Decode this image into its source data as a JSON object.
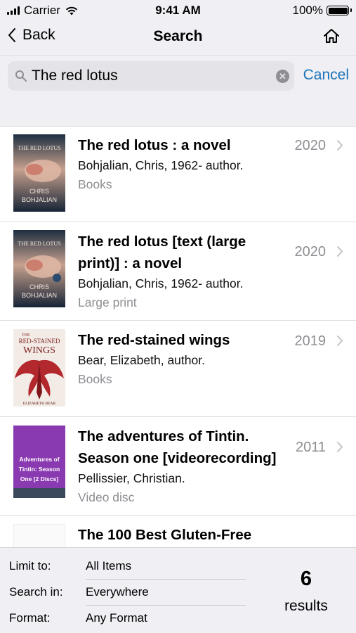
{
  "status_bar": {
    "carrier": "Carrier",
    "time": "9:41 AM",
    "battery": "100%"
  },
  "nav": {
    "back_label": "Back",
    "title": "Search"
  },
  "search": {
    "query": "The red lotus",
    "cancel_label": "Cancel"
  },
  "results": [
    {
      "title": "The red lotus : a novel",
      "author": "Bohjalian, Chris, 1962- author.",
      "format": "Books",
      "year": "2020",
      "cover": {
        "top_text": "THE RED LOTUS",
        "author_line1": "CHRIS",
        "author_line2": "BOHJALIAN"
      }
    },
    {
      "title": "The red lotus [text (large print)] : a novel",
      "author": "Bohjalian, Chris, 1962- author.",
      "format": "Large print",
      "year": "2020",
      "cover": {
        "top_text": "THE RED LOTUS",
        "author_line1": "CHRIS",
        "author_line2": "BOHJALIAN"
      }
    },
    {
      "title": "The red-stained wings",
      "author": "Bear, Elizabeth, author.",
      "format": "Books",
      "year": "2019",
      "cover": {
        "top_text": "THE",
        "title_line1": "RED-STAINED",
        "title_line2": "WINGS",
        "author_text": "ELIZABETH BEAR"
      }
    },
    {
      "title": "The adventures of Tintin. Season one [videorecording]",
      "author": "Pellissier, Christian.",
      "format": "Video disc",
      "year": "2011",
      "cover": {
        "text_line1": "Adventures of",
        "text_line2": "Tintin: Season",
        "text_line3": "One [2 Discs]"
      }
    },
    {
      "title": "The 100 Best Gluten-Free"
    }
  ],
  "filters": [
    {
      "label": "Limit to:",
      "value": "All Items"
    },
    {
      "label": "Search in:",
      "value": "Everywhere"
    },
    {
      "label": "Format:",
      "value": "Any Format"
    }
  ],
  "result_count": {
    "number": "6",
    "label": "results"
  },
  "colors": {
    "accent": "#1a73b8",
    "bar_background": "#efeff4",
    "secondary_text": "#8e8e93"
  }
}
